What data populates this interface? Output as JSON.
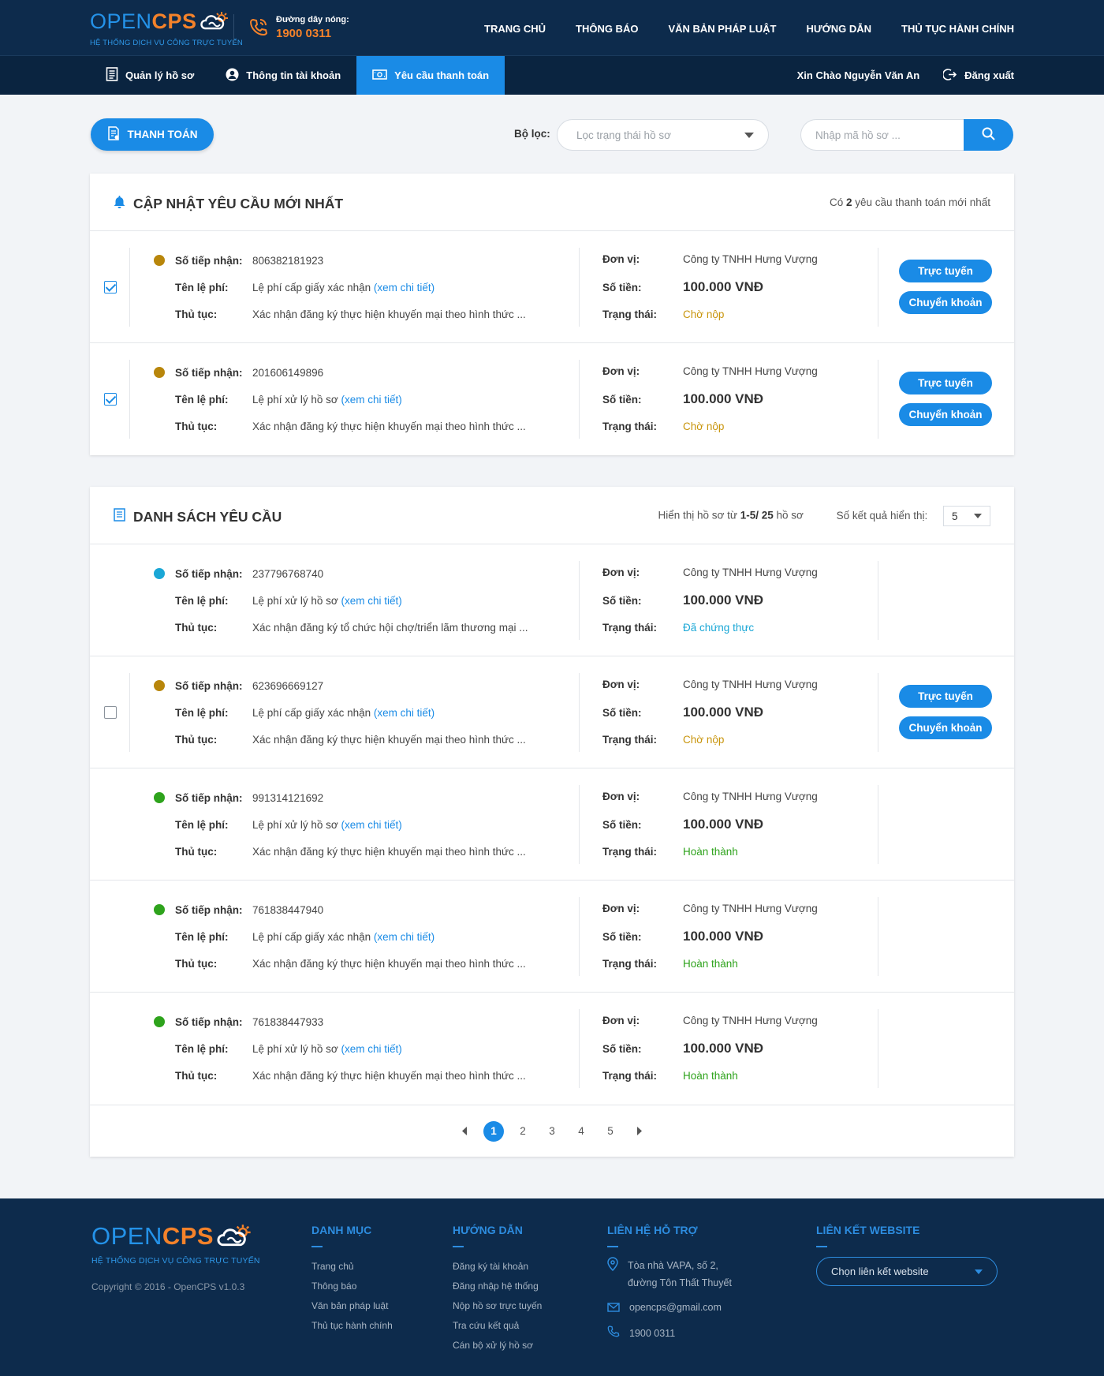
{
  "header": {
    "logo_open": "OPEN",
    "logo_cps": "CPS",
    "logo_sub": "HỆ THỐNG DỊCH VỤ CÔNG TRỰC TUYẾN",
    "hotline_label": "Đường dây nóng:",
    "hotline_number": "1900 0311",
    "nav": [
      "TRANG CHỦ",
      "THÔNG BÁO",
      "VĂN BẢN PHÁP LUẬT",
      "HƯỚNG DẪN",
      "THỦ TỤC HÀNH CHÍNH"
    ]
  },
  "subnav": {
    "tabs": [
      "Quản lý hồ sơ",
      "Thông tin tài khoản",
      "Yêu cầu thanh toán"
    ],
    "greeting": "Xin Chào Nguyễn Văn An",
    "logout": "Đăng xuất"
  },
  "toolbar": {
    "pay_button": "THANH TOÁN",
    "filter_label": "Bộ lọc:",
    "filter_placeholder": "Lọc trạng thái hồ sơ",
    "search_placeholder": "Nhập mã hồ sơ ..."
  },
  "labels": {
    "so_tiep_nhan": "Số tiếp nhận:",
    "ten_le_phi": "Tên lệ phí:",
    "thu_tuc": "Thủ tục:",
    "don_vi": "Đơn vị:",
    "so_tien": "Số tiền:",
    "trang_thai": "Trạng thái:",
    "xem_chi_tiet": "(xem chi tiết)",
    "btn_online": "Trực tuyến",
    "btn_transfer": "Chuyển khoản"
  },
  "latest": {
    "title": "CẬP NHẬT YÊU CẦU MỚI NHẤT",
    "meta_prefix": "Có ",
    "meta_count": "2",
    "meta_suffix": " yêu cầu thanh toán mới nhất",
    "rows": [
      {
        "checked": true,
        "dot_color": "#b8860b",
        "so": "806382181923",
        "fee": "Lệ phí cấp giấy xác nhận",
        "proc": "Xác nhận đăng ký thực hiện khuyến mại theo hình thức ...",
        "unit": "Công ty TNHH Hưng Vượng",
        "amount": "100.000 VNĐ",
        "status": "Chờ nộp",
        "status_color": "#c8940a",
        "actions": true
      },
      {
        "checked": true,
        "dot_color": "#b8860b",
        "so": "201606149896",
        "fee": "Lệ phí xử lý hồ sơ",
        "proc": "Xác nhận đăng ký thực hiện khuyến mại theo hình thức ...",
        "unit": "Công ty TNHH Hưng Vượng",
        "amount": "100.000 VNĐ",
        "status": "Chờ nộp",
        "status_color": "#c8940a",
        "actions": true
      }
    ]
  },
  "list": {
    "title": "DANH SÁCH YÊU CẦU",
    "range_prefix": "Hiển thị hồ sơ từ ",
    "range": "1-5/",
    "total": "25",
    "range_suffix": " hồ sơ",
    "pagesize_label": "Số kết quả hiển thị:",
    "pagesize": "5",
    "rows": [
      {
        "checkbox": false,
        "dot_color": "#1aa7d6",
        "so": "237796768740",
        "fee": "Lệ phí xử lý hồ sơ",
        "proc": "Xác nhận đăng ký tổ chức hội chợ/triển lãm thương mại ...",
        "unit": "Công ty TNHH Hưng Vượng",
        "amount": "100.000 VNĐ",
        "status": "Đã chứng thực",
        "status_color": "#1aa7d6",
        "actions": false
      },
      {
        "checkbox": true,
        "checked": false,
        "dot_color": "#b8860b",
        "so": "623696669127",
        "fee": "Lệ phí cấp giấy xác nhận",
        "proc": "Xác nhận đăng ký thực hiện khuyến mại theo hình thức ...",
        "unit": "Công ty TNHH Hưng Vượng",
        "amount": "100.000 VNĐ",
        "status": "Chờ nộp",
        "status_color": "#c8940a",
        "actions": true
      },
      {
        "checkbox": false,
        "dot_color": "#2ea31c",
        "so": "991314121692",
        "fee": "Lệ phí xử lý hồ sơ",
        "proc": "Xác nhận đăng ký thực hiện khuyến mại theo hình thức ...",
        "unit": "Công ty TNHH Hưng Vượng",
        "amount": "100.000 VNĐ",
        "status": "Hoàn thành",
        "status_color": "#2ea31c",
        "actions": false
      },
      {
        "checkbox": false,
        "dot_color": "#2ea31c",
        "so": "761838447940",
        "fee": "Lệ phí cấp giấy xác nhận",
        "proc": "Xác nhận đăng ký thực hiện khuyến mại theo hình thức ...",
        "unit": "Công ty TNHH Hưng Vượng",
        "amount": "100.000 VNĐ",
        "status": "Hoàn thành",
        "status_color": "#2ea31c",
        "actions": false
      },
      {
        "checkbox": false,
        "dot_color": "#2ea31c",
        "so": "761838447933",
        "fee": "Lệ phí xử lý hồ sơ",
        "proc": "Xác nhận đăng ký thực hiện khuyến mại theo hình thức ...",
        "unit": "Công ty TNHH Hưng Vượng",
        "amount": "100.000 VNĐ",
        "status": "Hoàn thành",
        "status_color": "#2ea31c",
        "actions": false
      }
    ],
    "pages": [
      "1",
      "2",
      "3",
      "4",
      "5"
    ],
    "current_page": "1"
  },
  "footer": {
    "copyright": "Copyright © 2016 - OpenCPS v1.0.3",
    "col1_title": "DANH MỤC",
    "col1_links": [
      "Trang chủ",
      "Thông báo",
      "Văn bản pháp luật",
      "Thủ tục hành chính"
    ],
    "col2_title": "HƯỚNG DẪN",
    "col2_links": [
      "Đăng ký tài khoản",
      "Đăng nhập hệ thống",
      "Nộp hồ sơ trực tuyến",
      "Tra cứu kết quả",
      "Cán bộ xử lý hồ sơ"
    ],
    "col3_title": "LIÊN HỆ HỖ TRỢ",
    "address_line1": "Tòa nhà VAPA, số 2,",
    "address_line2": "đường Tôn Thất Thuyết",
    "email": "opencps@gmail.com",
    "phone": "1900 0311",
    "col4_title": "LIÊN KẾT WEBSITE",
    "website_select": "Chọn liên kết website"
  },
  "colors": {
    "accent": "#1a8be6",
    "header_bg": "#0d2b4c",
    "logo_orange": "#f4822a"
  }
}
